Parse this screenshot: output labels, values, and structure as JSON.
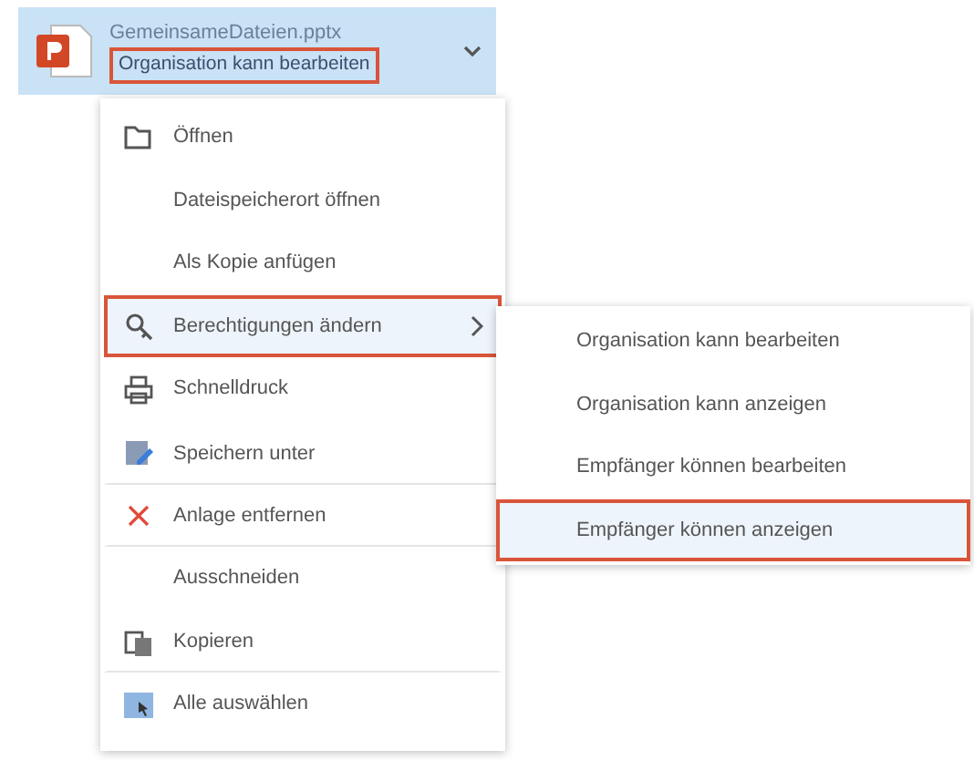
{
  "attachment": {
    "file_name": "GemeinsameDateien.pptx",
    "permission": "Organisation kann bearbeiten",
    "permission_highlighted": true
  },
  "menu": [
    {
      "kind": "open",
      "label": "Öffnen",
      "highlighted": false,
      "separator_after": false,
      "submenu": false
    },
    {
      "kind": "none",
      "label": "Dateispeicherort öffnen",
      "highlighted": false,
      "separator_after": false,
      "submenu": false
    },
    {
      "kind": "none",
      "label": "Als Kopie anfügen",
      "highlighted": false,
      "separator_after": false,
      "submenu": false
    },
    {
      "kind": "permissions",
      "label": "Berechtigungen ändern",
      "highlighted": true,
      "separator_after": false,
      "submenu": true
    },
    {
      "kind": "print",
      "label": "Schnelldruck",
      "highlighted": false,
      "separator_after": false,
      "submenu": false
    },
    {
      "kind": "save",
      "label": "Speichern unter",
      "highlighted": false,
      "separator_after": true,
      "submenu": false
    },
    {
      "kind": "remove",
      "label": "Anlage entfernen",
      "highlighted": false,
      "separator_after": true,
      "submenu": false
    },
    {
      "kind": "none",
      "label": "Ausschneiden",
      "highlighted": false,
      "separator_after": false,
      "submenu": false
    },
    {
      "kind": "copy",
      "label": "Kopieren",
      "highlighted": false,
      "separator_after": true,
      "submenu": false
    },
    {
      "kind": "select",
      "label": "Alle auswählen",
      "highlighted": false,
      "separator_after": false,
      "submenu": false
    }
  ],
  "submenu": [
    {
      "label": "Organisation kann bearbeiten",
      "highlighted": false
    },
    {
      "label": "Organisation kann anzeigen",
      "highlighted": false
    },
    {
      "label": "Empfänger können bearbeiten",
      "highlighted": false
    },
    {
      "label": "Empfänger können anzeigen",
      "highlighted": true
    }
  ]
}
